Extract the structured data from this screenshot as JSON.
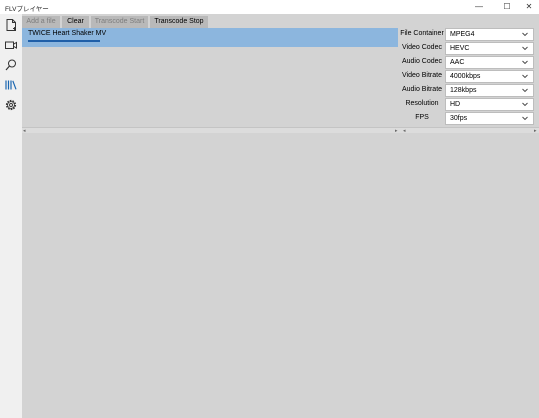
{
  "window": {
    "title": "FLVプレイヤー",
    "minimize_glyph": "—",
    "maximize_glyph": "☐",
    "close_glyph": "✕"
  },
  "sidebar": {
    "items": [
      {
        "icon": "file-icon"
      },
      {
        "icon": "video-camera-icon"
      },
      {
        "icon": "search-icon"
      },
      {
        "icon": "library-icon"
      },
      {
        "icon": "gear-icon"
      }
    ]
  },
  "toolbar": {
    "add_label": "Add a file",
    "clear_label": "Clear",
    "transcode_start_label": "Transcode Start",
    "transcode_stop_label": "Transcode Stop"
  },
  "file_list": {
    "items": [
      {
        "name": "TWICE Heart Shaker MV"
      }
    ]
  },
  "settings": {
    "file_container": {
      "label": "File Container",
      "value": "MPEG4"
    },
    "video_codec": {
      "label": "Video Codec",
      "value": "HEVC"
    },
    "audio_codec": {
      "label": "Audio Codec",
      "value": "AAC"
    },
    "video_bitrate": {
      "label": "Video Bitrate",
      "value": "4000kbps"
    },
    "audio_bitrate": {
      "label": "Audio Bitrate",
      "value": "128kbps"
    },
    "resolution": {
      "label": "Resolution",
      "value": "HD"
    },
    "fps": {
      "label": "FPS",
      "value": "30fps"
    }
  },
  "colors": {
    "selection": "#8cb6de",
    "background": "#d3d3d3",
    "button": "#b9b9b9"
  }
}
